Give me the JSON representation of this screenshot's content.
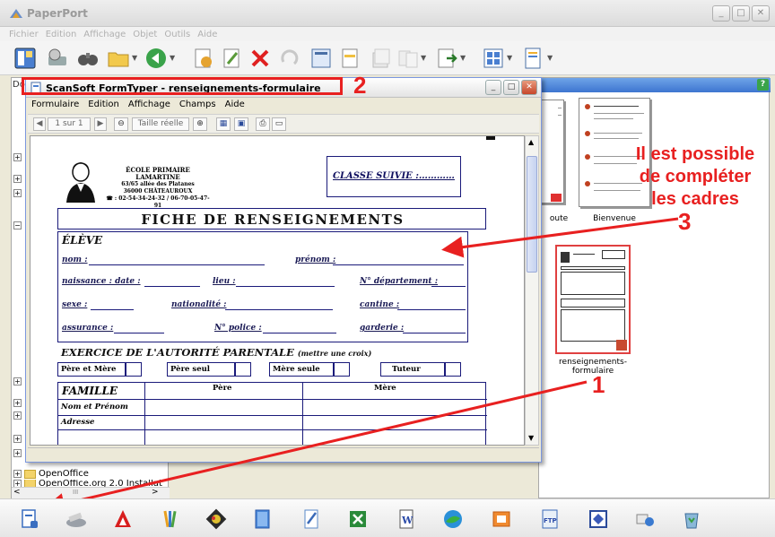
{
  "app": {
    "title": "PaperPort",
    "menu": [
      "Fichier",
      "Edition",
      "Affichage",
      "Objet",
      "Outils",
      "Aide"
    ]
  },
  "left_pane": {
    "label": "Do",
    "tree": [
      {
        "label": ""
      },
      {
        "label": "OpenOffice"
      },
      {
        "label": "OpenOffice.org 2.0 Installat"
      }
    ],
    "scroll_label": "III"
  },
  "right_pane": {
    "thumbnails": [
      {
        "caption": "oute"
      },
      {
        "caption": "Bienvenue"
      },
      {
        "caption": "renseignements-formulaire"
      }
    ]
  },
  "formtyper": {
    "title": "ScanSoft FormTyper - renseignements-formulaire",
    "menu": [
      "Formulaire",
      "Edition",
      "Affichage",
      "Champs",
      "Aide"
    ],
    "toolbar": {
      "page": "1 sur 1",
      "zoom_label": "Taille réelle"
    }
  },
  "form": {
    "school_lines": [
      "ÉCOLE PRIMAIRE LAMARTINE",
      "63/65 allée des Platanes",
      "36000  CHÂTEAUROUX",
      "☎ : 02-54-34-24-32 / 06-70-05-47-91"
    ],
    "classe": "CLASSE SUIVIE :…………",
    "title": "FICHE DE RENSEIGNEMENTS",
    "eleve": "ÉLÈVE",
    "fields": {
      "nom": "nom :",
      "prenom": "prénom :",
      "naissance": "naissance : date :",
      "lieu": "lieu :",
      "departement": "N° département :",
      "sexe": "sexe :",
      "nationalite": "nationalité :",
      "cantine": "cantine :",
      "assurance": "assurance :",
      "police": "N° police :",
      "garderie": "garderie :"
    },
    "exercice": "EXERCICE DE L'AUTORITÉ PARENTALE",
    "exercice_note": "(mettre une croix)",
    "choices": [
      "Père et Mère",
      "Père seul",
      "Mère seule",
      "Tuteur"
    ],
    "famille": {
      "header": "FAMILLE",
      "pere": "Père",
      "mere": "Mère",
      "rows": [
        "Nom et Prénom",
        "Adresse"
      ]
    }
  },
  "annotations": {
    "n1": "1",
    "n2": "2",
    "n3": "3",
    "note_lines": [
      "Il est possible",
      "de compléter",
      "les cadres"
    ],
    "color": "#e82020"
  },
  "taskbar": {
    "icons": [
      "paperport-doc-icon",
      "scanner-icon",
      "acrobat-icon",
      "paint-icon",
      "photo-icon",
      "book-icon",
      "notepad-icon",
      "excel-icon",
      "word-icon",
      "browser-icon",
      "outlook-icon",
      "ftp-icon",
      "viewer-icon",
      "mail-icon",
      "recycle-icon"
    ],
    "ftp_label": "FTP"
  }
}
